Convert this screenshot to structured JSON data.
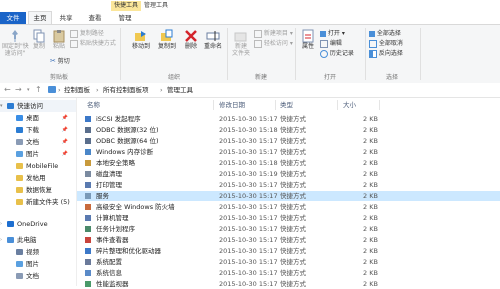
{
  "titlebar": {
    "context_tab": "快捷工具",
    "window_title": "管理工具",
    "tabs": [
      "文件",
      "主页",
      "共享",
      "查看",
      "管理"
    ]
  },
  "ribbon": {
    "clipboard": {
      "pin_quick_access": "固定到\"快\n速访问\"",
      "copy": "复制",
      "paste": "粘贴",
      "copy_path": "复制路径",
      "paste_shortcut": "粘贴快捷方式",
      "cut": "剪切",
      "group": "剪贴板"
    },
    "organize": {
      "move_to": "移动到",
      "copy_to": "复制到",
      "delete": "删除",
      "rename": "重命名",
      "group": "组织"
    },
    "new": {
      "new_folder": "新建\n文件夹",
      "new_item": "新建项目",
      "easy_access": "轻松访问",
      "group": "新建"
    },
    "open": {
      "properties": "属性",
      "open": "打开",
      "edit": "编辑",
      "history": "历史记录",
      "group": "打开"
    },
    "select": {
      "select_all": "全部选择",
      "select_none": "全部取消",
      "invert": "反向选择",
      "group": "选择"
    }
  },
  "address": {
    "crumbs": [
      "控制面板",
      "所有控制面板项",
      "管理工具"
    ]
  },
  "nav": {
    "items": [
      {
        "label": "快速访问",
        "icon": "star-icon",
        "color": "#2b7cd3",
        "indent": 0
      },
      {
        "label": "桌面",
        "icon": "desktop-icon",
        "color": "#3a8ee6",
        "indent": 1,
        "pinned": true
      },
      {
        "label": "下载",
        "icon": "download-icon",
        "color": "#2b7cd3",
        "indent": 1,
        "pinned": true
      },
      {
        "label": "文档",
        "icon": "document-icon",
        "color": "#8a9bb5",
        "indent": 1,
        "pinned": true
      },
      {
        "label": "图片",
        "icon": "picture-icon",
        "color": "#5aa0e0",
        "indent": 1,
        "pinned": true
      },
      {
        "label": "MobileFile",
        "icon": "folder-icon",
        "color": "#e8c04a",
        "indent": 1
      },
      {
        "label": "发帖用",
        "icon": "folder-icon",
        "color": "#e8c04a",
        "indent": 1
      },
      {
        "label": "数据恢复",
        "icon": "folder-icon",
        "color": "#e8c04a",
        "indent": 1
      },
      {
        "label": "新建文件夹 (5)",
        "icon": "folder-icon",
        "color": "#e8c04a",
        "indent": 1
      },
      {
        "label": "OneDrive",
        "icon": "cloud-icon",
        "color": "#1e6fd0",
        "indent": 0
      },
      {
        "label": "此电脑",
        "icon": "computer-icon",
        "color": "#4a8fd8",
        "indent": 0
      },
      {
        "label": "视频",
        "icon": "video-icon",
        "color": "#6a7fa0",
        "indent": 1
      },
      {
        "label": "图片",
        "icon": "picture-icon",
        "color": "#5aa0e0",
        "indent": 1
      },
      {
        "label": "文档",
        "icon": "document-icon",
        "color": "#8a9bb5",
        "indent": 1
      }
    ]
  },
  "list": {
    "headers": {
      "name": "名称",
      "date": "修改日期",
      "type": "类型",
      "size": "大小"
    },
    "rows": [
      {
        "name": "iSCSI 发起程序",
        "date": "2015-10-30 15:17",
        "type": "快捷方式",
        "size": "2 KB",
        "color": "#3c78c8"
      },
      {
        "name": "ODBC 数据源(32 位)",
        "date": "2015-10-30 15:18",
        "type": "快捷方式",
        "size": "2 KB",
        "color": "#5a6e8c"
      },
      {
        "name": "ODBC 数据源(64 位)",
        "date": "2015-10-30 15:17",
        "type": "快捷方式",
        "size": "2 KB",
        "color": "#5a6e8c"
      },
      {
        "name": "Windows 内存诊断",
        "date": "2015-10-30 15:17",
        "type": "快捷方式",
        "size": "2 KB",
        "color": "#4a86c8"
      },
      {
        "name": "本地安全策略",
        "date": "2015-10-30 15:18",
        "type": "快捷方式",
        "size": "2 KB",
        "color": "#c89a3c"
      },
      {
        "name": "磁盘清理",
        "date": "2015-10-30 15:19",
        "type": "快捷方式",
        "size": "2 KB",
        "color": "#7a8aa0"
      },
      {
        "name": "打印管理",
        "date": "2015-10-30 15:17",
        "type": "快捷方式",
        "size": "2 KB",
        "color": "#5a7ab0"
      },
      {
        "name": "服务",
        "date": "2015-10-30 15:17",
        "type": "快捷方式",
        "size": "2 KB",
        "color": "#7a9ab8",
        "selected": true
      },
      {
        "name": "高级安全 Windows 防火墙",
        "date": "2015-10-30 15:17",
        "type": "快捷方式",
        "size": "2 KB",
        "color": "#c86a3c"
      },
      {
        "name": "计算机管理",
        "date": "2015-10-30 15:17",
        "type": "快捷方式",
        "size": "2 KB",
        "color": "#5a7ab0"
      },
      {
        "name": "任务计划程序",
        "date": "2015-10-30 15:17",
        "type": "快捷方式",
        "size": "2 KB",
        "color": "#4a8a6a"
      },
      {
        "name": "事件查看器",
        "date": "2015-10-30 15:17",
        "type": "快捷方式",
        "size": "2 KB",
        "color": "#c8443c"
      },
      {
        "name": "碎片整理和优化驱动器",
        "date": "2015-10-30 15:17",
        "type": "快捷方式",
        "size": "2 KB",
        "color": "#3c78c8"
      },
      {
        "name": "系统配置",
        "date": "2015-10-30 15:17",
        "type": "快捷方式",
        "size": "2 KB",
        "color": "#6a7a9a"
      },
      {
        "name": "系统信息",
        "date": "2015-10-30 15:17",
        "type": "快捷方式",
        "size": "2 KB",
        "color": "#5a8ac8"
      },
      {
        "name": "性能监视器",
        "date": "2015-10-30 15:17",
        "type": "快捷方式",
        "size": "2 KB",
        "color": "#4a9a6a"
      }
    ]
  }
}
